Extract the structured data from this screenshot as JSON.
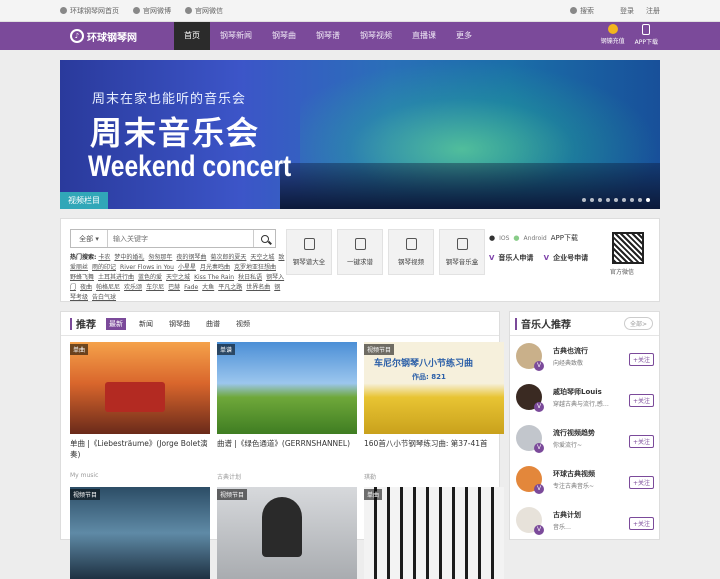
{
  "topbar": {
    "home": "环球钢琴网首页",
    "weibo": "官网微博",
    "wechat": "官网微信",
    "search": "搜索",
    "login": "登录",
    "register": "注册"
  },
  "nav": {
    "logo": "环球钢琴网",
    "items": [
      "首页",
      "钢琴新闻",
      "钢琴曲",
      "钢琴谱",
      "钢琴视频",
      "直播课",
      "更多"
    ],
    "recharge": "钢镚充值",
    "app": "APP下载"
  },
  "banner": {
    "line1": "周末在家也能听的音乐会",
    "line2": "周末音乐会",
    "line3": "Weekend concert",
    "tag": "视频栏目"
  },
  "search": {
    "select": "全部",
    "placeholder": "输入关键字",
    "hot_label": "热门搜索:",
    "hot": [
      "卡农",
      "梦中的婚礼",
      "匆匆那年",
      "夜的钢琴曲",
      "菊次郎的夏天",
      "天空之城",
      "致爱丽丝",
      "雨的印记",
      "River Flows in You",
      "小星星",
      "月光奏鸣曲",
      "克罗地亚狂想曲",
      "野蜂飞舞",
      "土耳其进行曲",
      "蓝色的爱",
      "天空之城",
      "Kiss The Rain",
      "秋日私语",
      "钢琴入门",
      "夜曲",
      "帕格尼尼",
      "欢乐颂",
      "车尔尼",
      "巴赫",
      "Fade",
      "大鱼",
      "平凡之路",
      "世界名曲",
      "钢琴考级",
      "告白气球"
    ]
  },
  "quick": [
    "钢琴谱大全",
    "一键求谱",
    "钢琴视频",
    "钢琴音乐盒"
  ],
  "apps": {
    "ios": "IOS",
    "android": "Android",
    "download": "APP下载",
    "music": "音乐人申请",
    "company": "企业号申请",
    "qr": "官方微信"
  },
  "rec": {
    "title": "推荐",
    "tabs": [
      "最新",
      "新闻",
      "钢琴曲",
      "曲谱",
      "视频"
    ],
    "cards": [
      {
        "badge": "单曲",
        "title": "单曲 |《Liebesträume》(Jorge Bolet演奏)",
        "src": "My music"
      },
      {
        "badge": "单谱",
        "title": "曲谱 |《绿色通道》(GERRNSHANNEL)",
        "src": "古典计划"
      },
      {
        "badge": "视频节目",
        "title": "160首八小节钢琴练习曲: 第37-41首",
        "src": "琪勒",
        "img_text": "车尼尔钢琴八小节练习曲",
        "img_text2": "作品: 821"
      },
      {
        "badge": "视频节目",
        "title": "",
        "src": ""
      },
      {
        "badge": "视频节目",
        "title": "",
        "src": ""
      },
      {
        "badge": "单曲",
        "title": "",
        "src": ""
      }
    ]
  },
  "side": {
    "title": "音乐人推荐",
    "all": "全部>",
    "follow": "+关注",
    "users": [
      {
        "name": "古典也流行",
        "desc": "向经典致敬"
      },
      {
        "name": "戚珀琴师Louis",
        "desc": "穿越古典与流行,感…"
      },
      {
        "name": "流行视频趋势",
        "desc": "你爱流行~"
      },
      {
        "name": "环球古典视频",
        "desc": "专注古典音乐~"
      },
      {
        "name": "古典计划",
        "desc": "音乐…"
      }
    ]
  }
}
